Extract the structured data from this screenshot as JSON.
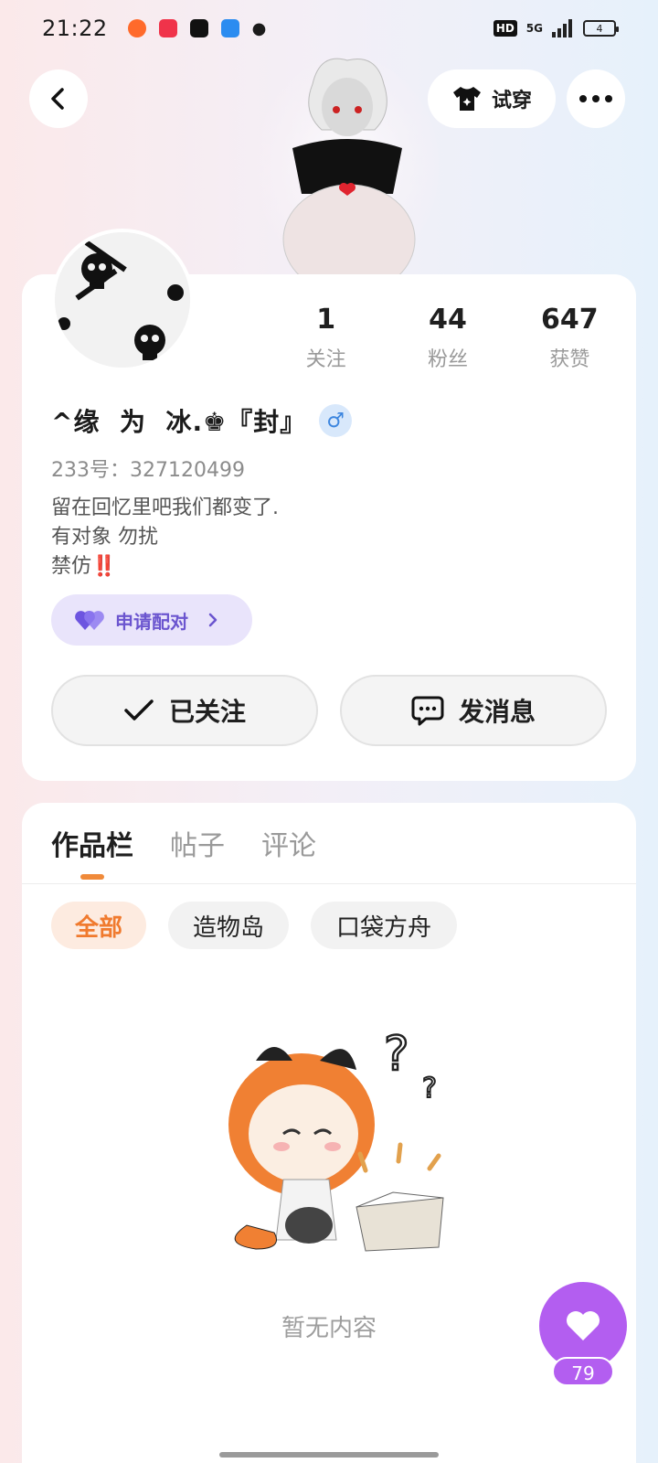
{
  "status_bar": {
    "time": "21:22",
    "network": "5G",
    "battery": "4",
    "hd": "HD"
  },
  "header": {
    "try_on_label": "试穿"
  },
  "profile": {
    "stats": [
      {
        "value": "1",
        "label": "关注"
      },
      {
        "value": "44",
        "label": "粉丝"
      },
      {
        "value": "647",
        "label": "获赞"
      }
    ],
    "nickname": "^缘  为  冰.♚『封』",
    "gender_symbol": "♂",
    "uid": "233号：327120499",
    "bio_lines": [
      "留在回忆里吧我们都变了.",
      "有对象 勿扰",
      "禁仿"
    ],
    "bio_mark": "‼️",
    "pair_button": "申请配对",
    "follow_button": "已关注",
    "message_button": "发消息"
  },
  "works": {
    "tabs": [
      "作品栏",
      "帖子",
      "评论"
    ],
    "filters": [
      "全部",
      "造物岛",
      "口袋方舟"
    ],
    "empty_text": "暂无内容"
  },
  "fab": {
    "like_count": "79",
    "color": "#b35ef0"
  }
}
